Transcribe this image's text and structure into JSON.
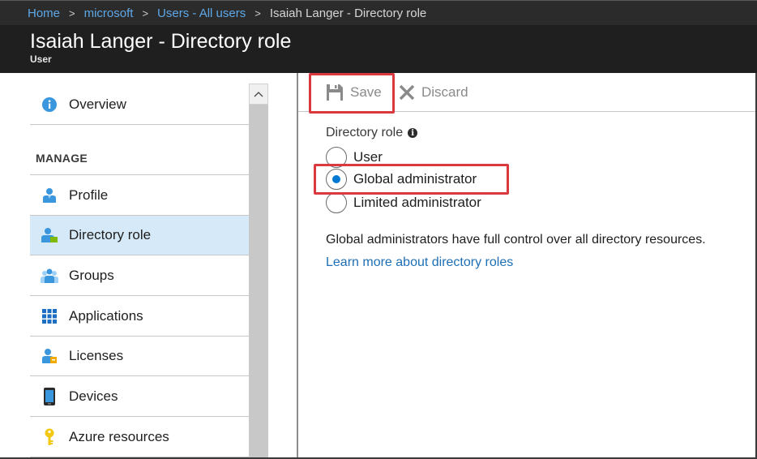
{
  "breadcrumb": {
    "items": [
      "Home",
      "microsoft",
      "Users - All users"
    ],
    "current": "Isaiah Langer - Directory role"
  },
  "blade": {
    "title": "Isaiah Langer - Directory role",
    "subtitle": "User"
  },
  "menu": {
    "overview": "Overview",
    "section_label": "MANAGE",
    "items": [
      {
        "label": "Profile",
        "icon": "profile-icon"
      },
      {
        "label": "Directory role",
        "icon": "directory-role-icon",
        "active": true
      },
      {
        "label": "Groups",
        "icon": "groups-icon"
      },
      {
        "label": "Applications",
        "icon": "applications-icon"
      },
      {
        "label": "Licenses",
        "icon": "licenses-icon"
      },
      {
        "label": "Devices",
        "icon": "devices-icon"
      },
      {
        "label": "Azure resources",
        "icon": "key-icon"
      }
    ]
  },
  "toolbar": {
    "save_label": "Save",
    "discard_label": "Discard"
  },
  "content": {
    "field_label": "Directory role",
    "options": [
      {
        "label": "User",
        "selected": false
      },
      {
        "label": "Global administrator",
        "selected": true
      },
      {
        "label": "Limited administrator",
        "selected": false
      }
    ],
    "description": "Global administrators have full control over all directory resources.",
    "learn_more": "Learn more about directory roles"
  },
  "colors": {
    "accent": "#0078d4",
    "highlight": "#d9393f",
    "active_menu": "#d5e9f8",
    "link": "#1e6fb5"
  }
}
